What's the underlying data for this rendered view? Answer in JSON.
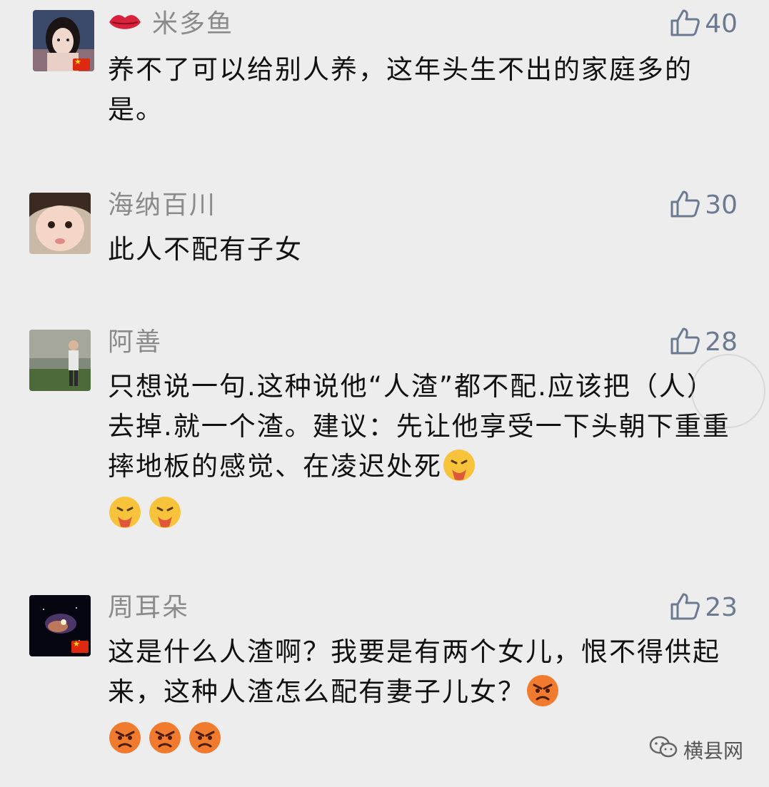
{
  "colors": {
    "background": "#ededed",
    "username": "#8a8a8a",
    "like": "#6b7a90",
    "text": "#111111"
  },
  "comments": [
    {
      "username": "米多鱼",
      "likes": "40",
      "text": "养不了可以给别人养，这年头生不出的家庭多的是。",
      "badge": "lips-icon",
      "avatar": "woman-selfie-avatar",
      "flag": true
    },
    {
      "username": "海纳百川",
      "likes": "30",
      "text": "此人不配有子女",
      "avatar": "child-face-avatar",
      "flag": false
    },
    {
      "username": "阿善",
      "likes": "28",
      "text": "只想说一句.这种说他“人渣”都不配.应该把（人）去掉.就一个渣。建议：先让他享受一下头朝下重重摔地板的感觉、在凌迟处死",
      "emoji": "vomiting-face-icon",
      "emoji_count": 3,
      "avatar": "man-outdoor-avatar",
      "flag": false
    },
    {
      "username": "周耳朵",
      "likes": "23",
      "text": "这是什么人渣啊？我要是有两个女儿，恨不得供起来，这种人渣怎么配有妻子儿女？",
      "emoji": "angry-face-icon",
      "emoji_count": 4,
      "avatar": "galaxy-avatar",
      "flag": true
    }
  ],
  "footer": {
    "label": "横县网",
    "icon": "wechat-icon"
  }
}
